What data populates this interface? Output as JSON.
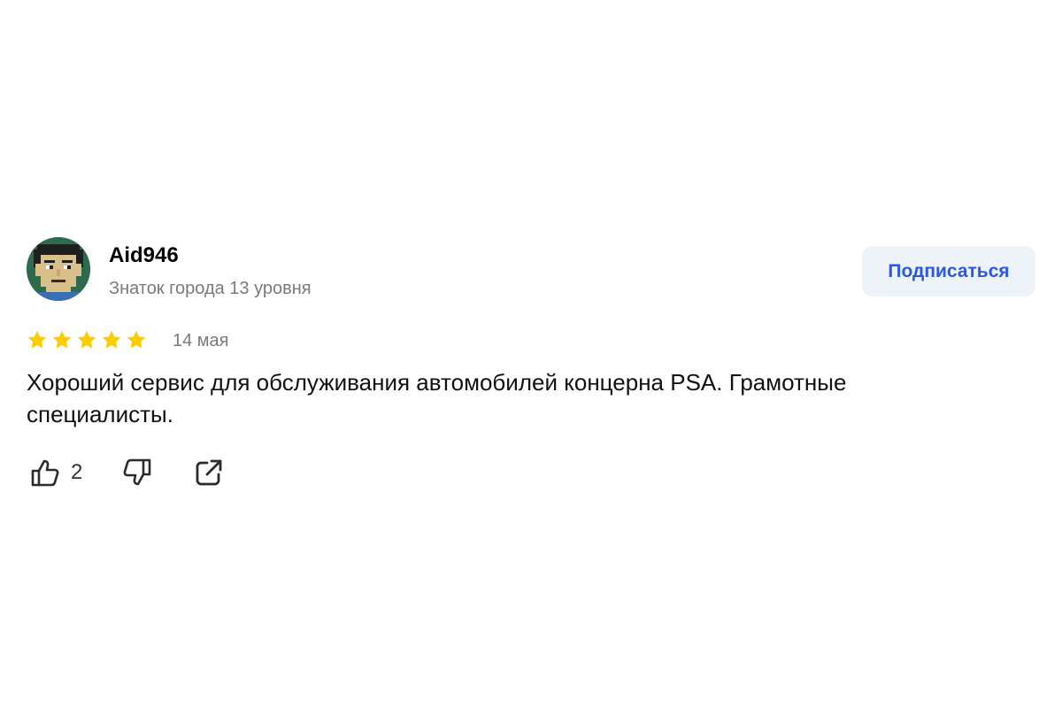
{
  "review": {
    "author": {
      "name": "Aid946",
      "level": "Знаток города 13 уровня",
      "avatar_icon": "pixel-art-face-avatar"
    },
    "subscribe_label": "Подписаться",
    "rating": {
      "value": 5,
      "max": 5,
      "star_color": "#ffcc00"
    },
    "date": "14 мая",
    "text": "Хороший сервис для обслуживания автомобилей концерна PSA. Грамотные специалисты.",
    "actions": {
      "like_icon": "thumbs-up-icon",
      "like_count": "2",
      "dislike_icon": "thumbs-down-icon",
      "share_icon": "share-icon"
    }
  },
  "colors": {
    "accent": "#2a58e4",
    "button_bg": "#eef2f9",
    "secondary_text": "#7a7a7a"
  }
}
